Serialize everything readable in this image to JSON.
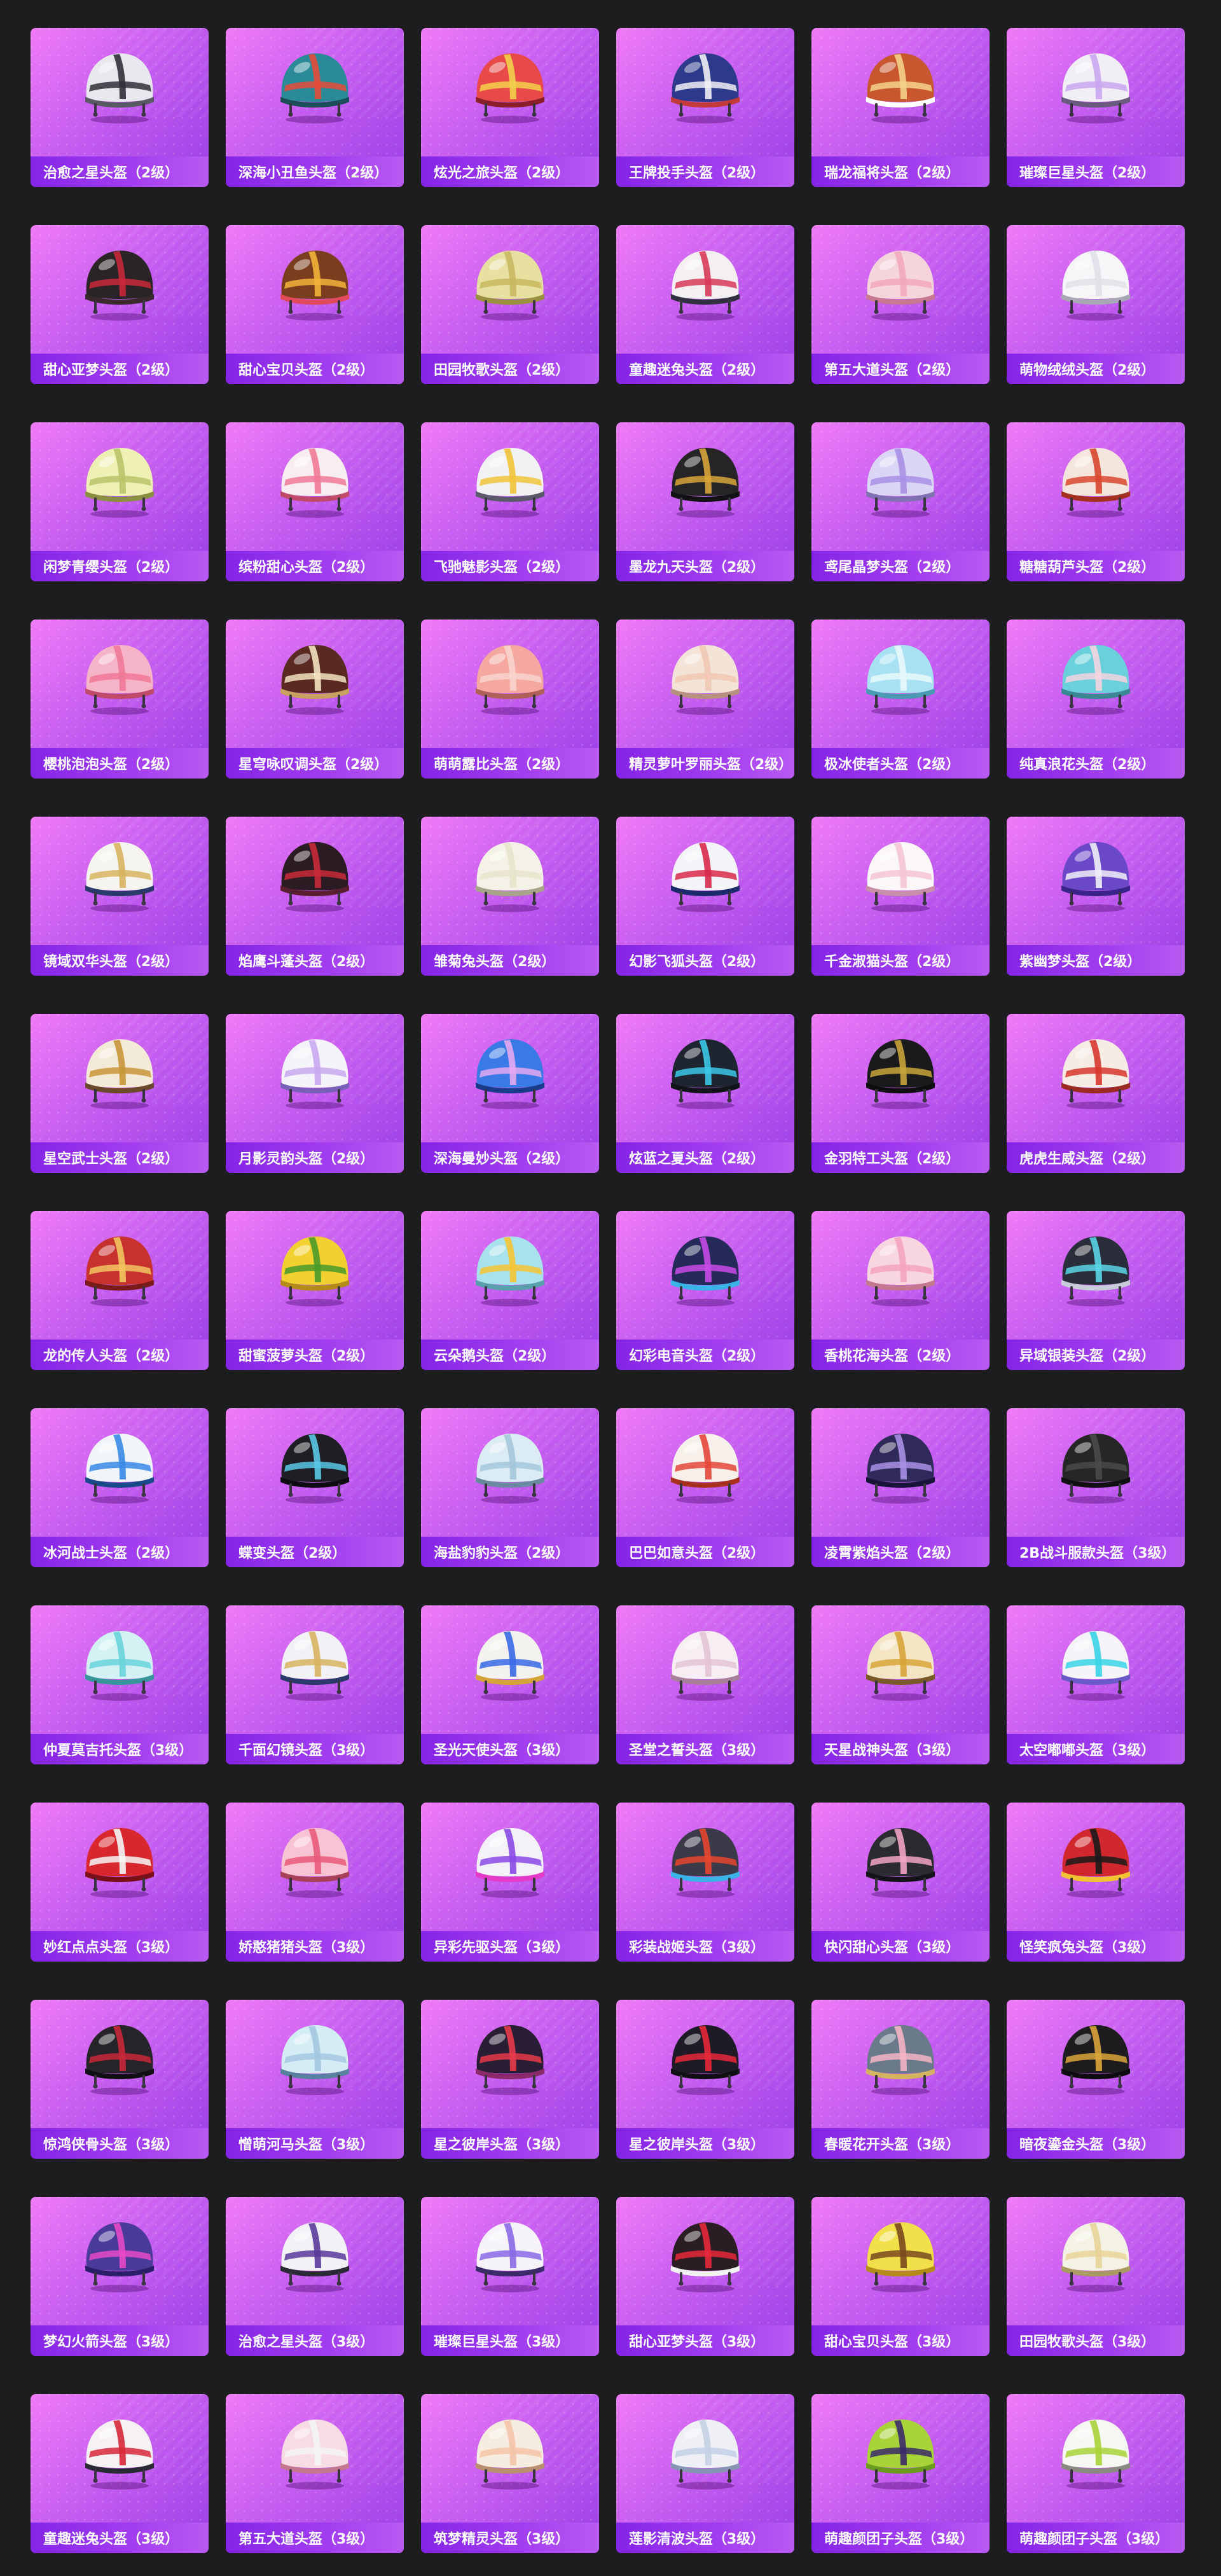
{
  "gallery": {
    "items": [
      {
        "label": "治愈之星头盔（2级）",
        "shell": "#e8e8ee",
        "accent": "#303038",
        "rim": "#5a5a66"
      },
      {
        "label": "深海小丑鱼头盔（2级）",
        "shell": "#2a8a98",
        "accent": "#e64a3a",
        "rim": "#1a4f5a"
      },
      {
        "label": "炫光之旅头盔（2级）",
        "shell": "#e84a4a",
        "accent": "#f2d04a",
        "rim": "#8a1f2a"
      },
      {
        "label": "王牌投手头盔（2级）",
        "shell": "#2d3a8c",
        "accent": "#f0f0f4",
        "rim": "#c23a3a"
      },
      {
        "label": "瑞龙福将头盔（2级）",
        "shell": "#c8562e",
        "accent": "#f4d28a",
        "rim": "#ffffff"
      },
      {
        "label": "璀璨巨星头盔（2级）",
        "shell": "#f2eef6",
        "accent": "#c9a6f0",
        "rim": "#6a5a80"
      },
      {
        "label": "甜心亚梦头盔（2级）",
        "shell": "#2a2426",
        "accent": "#c8283a",
        "rim": "#3a2a2e"
      },
      {
        "label": "甜心宝贝头盔（2级）",
        "shell": "#7a3e1e",
        "accent": "#f2b23a",
        "rim": "#e04a5a"
      },
      {
        "label": "田园牧歌头盔（2级）",
        "shell": "#e8e0a0",
        "accent": "#c8b860",
        "rim": "#9a9040"
      },
      {
        "label": "童趣迷兔头盔（2级）",
        "shell": "#f4f0f2",
        "accent": "#d83a5a",
        "rim": "#303040"
      },
      {
        "label": "第五大道头盔（2级）",
        "shell": "#f6d4dc",
        "accent": "#f2a8bc",
        "rim": "#c87890"
      },
      {
        "label": "萌物绒绒头盔（2级）",
        "shell": "#f6f6f8",
        "accent": "#e0e0e8",
        "rim": "#a8a8b4"
      },
      {
        "label": "闲梦青缨头盔（2级）",
        "shell": "#eef0b4",
        "accent": "#b8c46a",
        "rim": "#8a9040"
      },
      {
        "label": "缤粉甜心头盔（2级）",
        "shell": "#f8eef2",
        "accent": "#f07896",
        "rim": "#c04a6a"
      },
      {
        "label": "飞驰魅影头盔（2级）",
        "shell": "#f2f2f4",
        "accent": "#f0c43a",
        "rim": "#5a5a6a"
      },
      {
        "label": "墨龙九天头盔（2级）",
        "shell": "#262426",
        "accent": "#d8a43a",
        "rim": "#121214"
      },
      {
        "label": "鸢尾晶梦头盔（2级）",
        "shell": "#dcd6f6",
        "accent": "#a890e6",
        "rim": "#8070b4"
      },
      {
        "label": "糖糖葫芦头盔（2级）",
        "shell": "#f4e6dc",
        "accent": "#d8462e",
        "rim": "#a43020"
      },
      {
        "label": "樱桃泡泡头盔（2级）",
        "shell": "#f6b4c8",
        "accent": "#f07898",
        "rim": "#c04a6a"
      },
      {
        "label": "星穹咏叹调头盔（2级）",
        "shell": "#5a2a22",
        "accent": "#f2e2c0",
        "rim": "#c8a060"
      },
      {
        "label": "萌萌露比头盔（2级）",
        "shell": "#f4a8a0",
        "accent": "#f8d4cc",
        "rim": "#b06058"
      },
      {
        "label": "精灵萝叶罗丽头盔（2级）",
        "shell": "#f4e4d8",
        "accent": "#f0c8b4",
        "rim": "#b89080"
      },
      {
        "label": "极冰使者头盔（2级）",
        "shell": "#a8e2f2",
        "accent": "#e8f8fc",
        "rim": "#4a9ab4"
      },
      {
        "label": "纯真浪花头盔（2级）",
        "shell": "#6ad0dc",
        "accent": "#f4d4e0",
        "rim": "#3a8894"
      },
      {
        "label": "镜域双华头盔（2级）",
        "shell": "#f6f4ee",
        "accent": "#d8b460",
        "rim": "#2a3a6a"
      },
      {
        "label": "焰鹰斗蓬头盔（2级）",
        "shell": "#2a1c22",
        "accent": "#c82a3a",
        "rim": "#5a2030"
      },
      {
        "label": "雏菊兔头盔（2级）",
        "shell": "#f4f2e6",
        "accent": "#e8e4cc",
        "rim": "#a8a48a"
      },
      {
        "label": "幻影飞狐头盔（2级）",
        "shell": "#f4f4f8",
        "accent": "#d82a4a",
        "rim": "#1a2a6a"
      },
      {
        "label": "千金淑猫头盔（2级）",
        "shell": "#fbf6f8",
        "accent": "#f4c4d4",
        "rim": "#c890a8"
      },
      {
        "label": "紫幽梦头盔（2级）",
        "shell": "#6a48c8",
        "accent": "#f0f0f8",
        "rim": "#3a2488"
      },
      {
        "label": "星空武士头盔（2级）",
        "shell": "#f4ead8",
        "accent": "#c8963a",
        "rim": "#6a4a2a"
      },
      {
        "label": "月影灵韵头盔（2级）",
        "shell": "#f4f4fa",
        "accent": "#c8a8f0",
        "rim": "#7860b8"
      },
      {
        "label": "深海曼妙头盔（2级）",
        "shell": "#3a7ae6",
        "accent": "#e4a8f0",
        "rim": "#1a3a8a"
      },
      {
        "label": "炫蓝之夏头盔（2级）",
        "shell": "#1e2430",
        "accent": "#3ac8e6",
        "rim": "#101418"
      },
      {
        "label": "金羽特工头盔（2级）",
        "shell": "#1a1a1c",
        "accent": "#c8a43a",
        "rim": "#0e0e10"
      },
      {
        "label": "虎虎生威头盔（2级）",
        "shell": "#f6ece4",
        "accent": "#d8382e",
        "rim": "#9a2a22"
      },
      {
        "label": "龙的传人头盔（2级）",
        "shell": "#c8322e",
        "accent": "#f2c460",
        "rim": "#7a1a1a"
      },
      {
        "label": "甜蜜菠萝头盔（2级）",
        "shell": "#f2d030",
        "accent": "#4a9a2a",
        "rim": "#b48a18"
      },
      {
        "label": "云朵鹅头盔（2级）",
        "shell": "#a8e2ec",
        "accent": "#f4c434",
        "rim": "#5aa0ac"
      },
      {
        "label": "幻彩电音头盔（2级）",
        "shell": "#262a5a",
        "accent": "#c84ae6",
        "rim": "#3ab4e6"
      },
      {
        "label": "香桃花海头盔（2级）",
        "shell": "#f8d6e0",
        "accent": "#f4a4bc",
        "rim": "#c4788e"
      },
      {
        "label": "异域银装头盔（2级）",
        "shell": "#2a2e3a",
        "accent": "#5ad4e6",
        "rim": "#c8ccd8"
      },
      {
        "label": "冰河战士头盔（2级）",
        "shell": "#f2f6fa",
        "accent": "#3a8ae6",
        "rim": "#1a4a8a"
      },
      {
        "label": "蝶变头盔（2级）",
        "shell": "#1e1e24",
        "accent": "#5ac8e6",
        "rim": "#0c0c10"
      },
      {
        "label": "海盐豹豹头盔（2级）",
        "shell": "#dcecf4",
        "accent": "#a4c8dc",
        "rim": "#6a8aa0"
      },
      {
        "label": "巴巴如意头盔（2级）",
        "shell": "#f8f0ea",
        "accent": "#e4463a",
        "rim": "#a8301e"
      },
      {
        "label": "凌霄紫焰头盔（2级）",
        "shell": "#302a5a",
        "accent": "#a890e6",
        "rim": "#18143a"
      },
      {
        "label": "2B战斗服款头盔（3级）",
        "shell": "#262626",
        "accent": "#4a4a4a",
        "rim": "#101010"
      },
      {
        "label": "仲夏莫吉托头盔（3级）",
        "shell": "#d4f2f4",
        "accent": "#6ad4dc",
        "rim": "#3a949c"
      },
      {
        "label": "千面幻镜头盔（3级）",
        "shell": "#f2f2f6",
        "accent": "#d8b460",
        "rim": "#2a3a6a"
      },
      {
        "label": "圣光天使头盔（3级）",
        "shell": "#f4f2ee",
        "accent": "#3a6ae6",
        "rim": "#d4a43a"
      },
      {
        "label": "圣堂之誓头盔（3级）",
        "shell": "#f6eef2",
        "accent": "#e4c4d4",
        "rim": "#a8809a"
      },
      {
        "label": "天星战神头盔（3级）",
        "shell": "#f4e6c4",
        "accent": "#d8a43a",
        "rim": "#7a5a2a"
      },
      {
        "label": "太空嘟嘟头盔（3级）",
        "shell": "#f6f4f8",
        "accent": "#3ad4e6",
        "rim": "#6a5ac8"
      },
      {
        "label": "妙红点点头盔（3级）",
        "shell": "#d8282e",
        "accent": "#f6f6f6",
        "rim": "#7a1018"
      },
      {
        "label": "娇憨猪猪头盔（3级）",
        "shell": "#f8c4d4",
        "accent": "#e85a7a",
        "rim": "#a8405a"
      },
      {
        "label": "异彩先驱头盔（3级）",
        "shell": "#f4f2f8",
        "accent": "#8a4ae6",
        "rim": "#e43ac8"
      },
      {
        "label": "彩装战姬头盔（3级）",
        "shell": "#3a3a48",
        "accent": "#e6462e",
        "rim": "#3ab4e6"
      },
      {
        "label": "快闪甜心头盔（3级）",
        "shell": "#2a2a30",
        "accent": "#f2a4c4",
        "rim": "#141418"
      },
      {
        "label": "怪笑疯兔头盔（3级）",
        "shell": "#d0282e",
        "accent": "#1a1a1a",
        "rim": "#f2c434"
      },
      {
        "label": "惊鸿侠骨头盔（3级）",
        "shell": "#262428",
        "accent": "#c8283a",
        "rim": "#101012"
      },
      {
        "label": "憎萌河马头盔（3级）",
        "shell": "#d4ecf4",
        "accent": "#a4c8e0",
        "rim": "#5a80a0"
      },
      {
        "label": "星之彼岸头盔（3级）",
        "shell": "#2a1e34",
        "accent": "#e63a4a",
        "rim": "#8a2a6a"
      },
      {
        "label": "星之彼岸头盔（3级）",
        "shell": "#1e1a26",
        "accent": "#e6283a",
        "rim": "#101014"
      },
      {
        "label": "春暖花开头盔（3级）",
        "shell": "#6a7a8a",
        "accent": "#f4b4c4",
        "rim": "#d4b460"
      },
      {
        "label": "暗夜鎏金头盔（3级）",
        "shell": "#1e1c1e",
        "accent": "#d8a43a",
        "rim": "#0e0c0e"
      },
      {
        "label": "梦幻火箭头盔（3级）",
        "shell": "#4a3a9a",
        "accent": "#e64ac8",
        "rim": "#2a1e6a"
      },
      {
        "label": "治愈之星头盔（3级）",
        "shell": "#f2f2f6",
        "accent": "#5a3a9a",
        "rim": "#2a2a36"
      },
      {
        "label": "璀璨巨星头盔（3级）",
        "shell": "#f6f4fa",
        "accent": "#8a6ae6",
        "rim": "#3a2a6a"
      },
      {
        "label": "甜心亚梦头盔（3级）",
        "shell": "#2a1e24",
        "accent": "#e6283a",
        "rim": "#f2f2f2"
      },
      {
        "label": "甜心宝贝头盔（3级）",
        "shell": "#f2e04a",
        "accent": "#7a4a1e",
        "rim": "#b48a18"
      },
      {
        "label": "田园牧歌头盔（3级）",
        "shell": "#f4f2e4",
        "accent": "#e8d49a",
        "rim": "#a89a60"
      },
      {
        "label": "童趣迷兔头盔（3级）",
        "shell": "#f6f2f4",
        "accent": "#d8283a",
        "rim": "#2a2a34"
      },
      {
        "label": "第五大道头盔（3级）",
        "shell": "#f8dce4",
        "accent": "#f4f4f6",
        "rim": "#c47890"
      },
      {
        "label": "筑梦精灵头盔（3级）",
        "shell": "#f6ece0",
        "accent": "#f4c4a8",
        "rim": "#b89070"
      },
      {
        "label": "莲影清波头盔（3级）",
        "shell": "#eef0f6",
        "accent": "#c4d0e6",
        "rim": "#8894b4"
      },
      {
        "label": "萌趣颜团子头盔（3级）",
        "shell": "#a8d43a",
        "accent": "#3a2a6a",
        "rim": "#6a9a1e"
      },
      {
        "label": "萌趣颜团子头盔（3级）",
        "shell": "#f6f6f2",
        "accent": "#a8d43a",
        "rim": "#8a8a80"
      }
    ]
  }
}
